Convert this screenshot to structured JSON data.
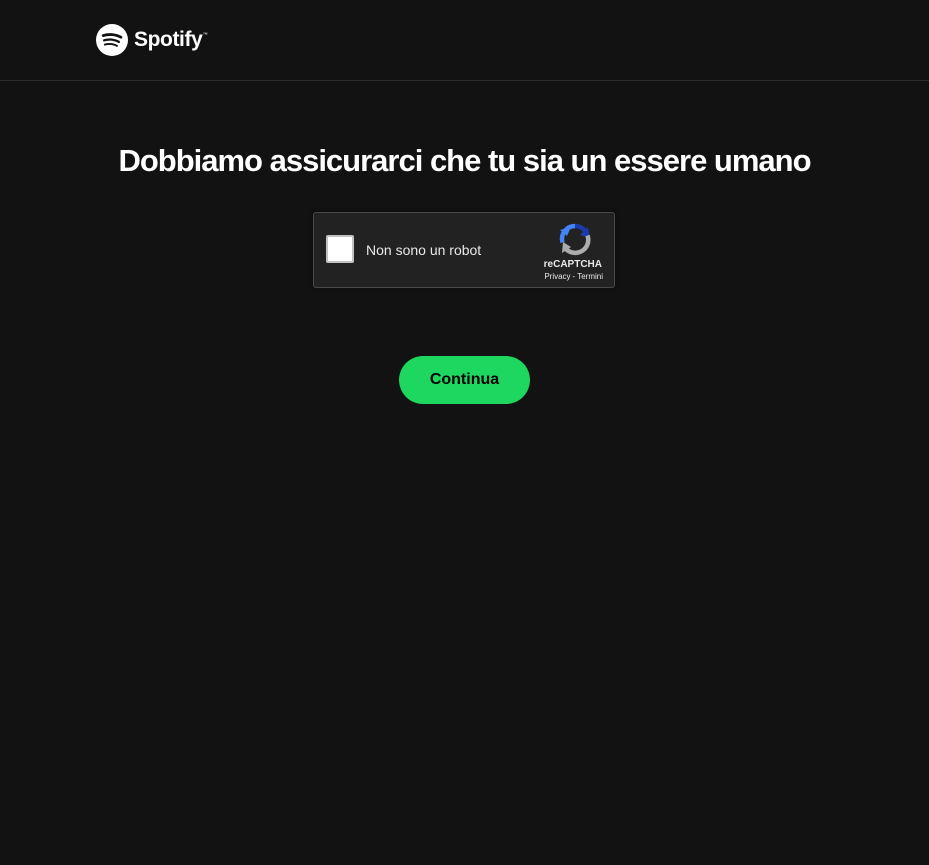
{
  "header": {
    "logo_text": "Spotify",
    "logo_trademark": "™",
    "logo_icon": "spotify-logo-icon"
  },
  "main": {
    "title": "Dobbiamo assicurarci che tu sia un essere umano",
    "continue_label": "Continua"
  },
  "recaptcha": {
    "checkbox_label": "Non sono un robot",
    "brand": "reCAPTCHA",
    "privacy_link": "Privacy",
    "separator": "-",
    "terms_link": "Termini",
    "logo_icon": "recaptcha-logo-icon",
    "checked": false
  },
  "colors": {
    "background": "#121212",
    "accent": "#1ed760",
    "text": "#ffffff",
    "widget_background": "#222222"
  }
}
